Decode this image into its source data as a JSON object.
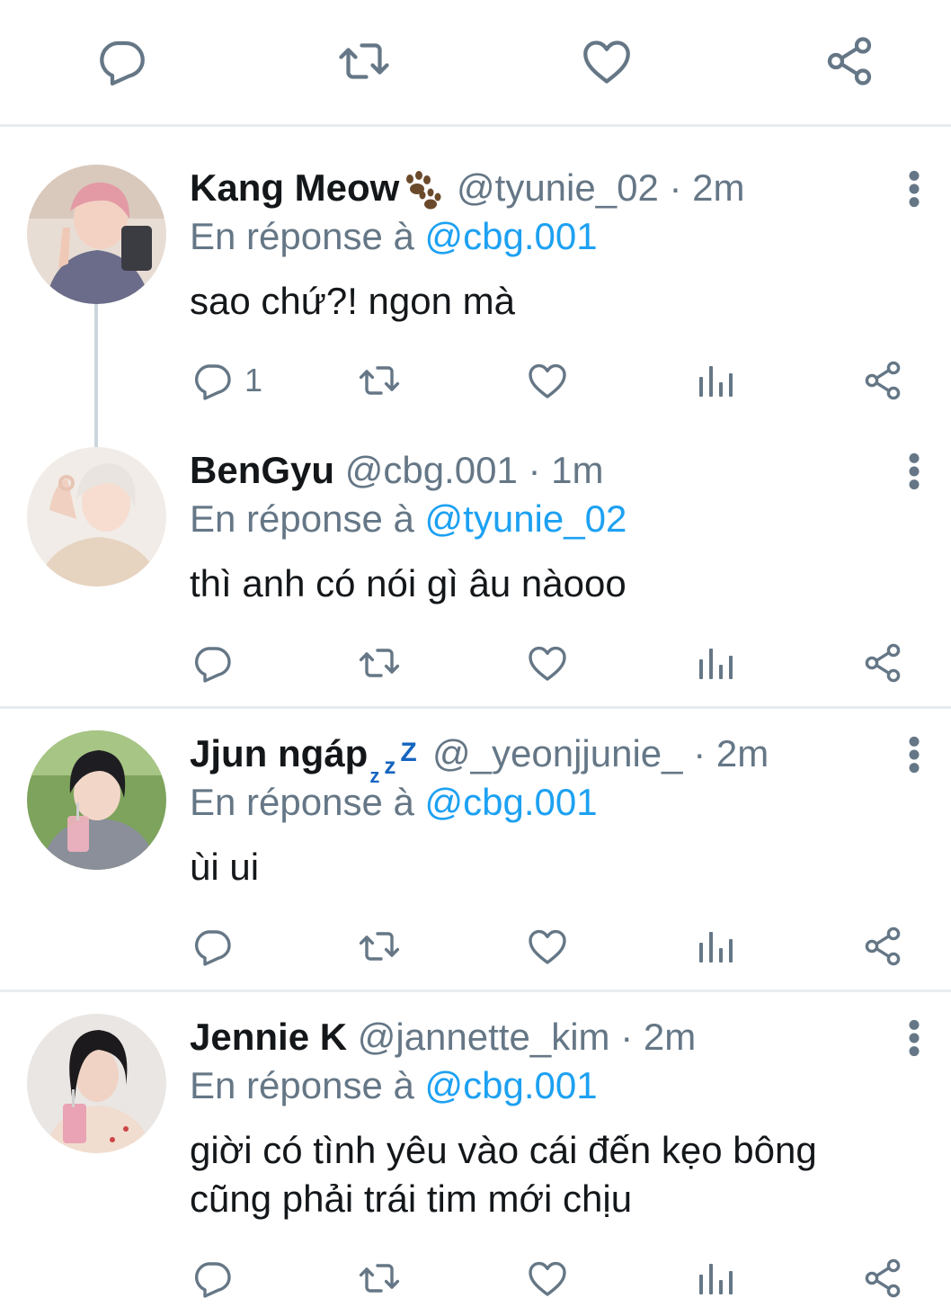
{
  "top_actions": [
    "reply-icon",
    "retweet-icon",
    "like-icon",
    "share-icon"
  ],
  "tweets": [
    {
      "name": "Kang Meow",
      "name_emoji": "paw-prints-emoji",
      "handle": "@tyunie_02",
      "dot": "·",
      "time": "2m",
      "reply_prefix": "En réponse à",
      "reply_to": "@cbg.001",
      "text": "sao chứ?! ngon mà",
      "reply_count": "1"
    },
    {
      "name": "BenGyu",
      "handle": "@cbg.001",
      "dot": "·",
      "time": "1m",
      "reply_prefix": "En réponse à",
      "reply_to": "@tyunie_02",
      "text": "thì anh có nói gì âu nàooo",
      "reply_count": ""
    },
    {
      "name": "Jjun ngáp",
      "name_emoji": "zzz-emoji",
      "handle": "@_yeonjjunie_",
      "dot": "·",
      "time": "2m",
      "reply_prefix": "En réponse à",
      "reply_to": "@cbg.001",
      "text": "ùi ui",
      "reply_count": ""
    },
    {
      "name": "Jennie K",
      "handle": "@jannette_kim",
      "dot": "·",
      "time": "2m",
      "reply_prefix": "En réponse à",
      "reply_to": "@cbg.001",
      "text_lines": [
        "giời có tình yêu vào cái đến kẹo bông",
        "cũng phải trái tim mới chịu"
      ],
      "reply_count": ""
    }
  ],
  "colors": {
    "icon_gray": "#657786",
    "mention_blue": "#1da1f2",
    "divider": "#e6ecf0",
    "thread_line": "#ccd6dd"
  }
}
